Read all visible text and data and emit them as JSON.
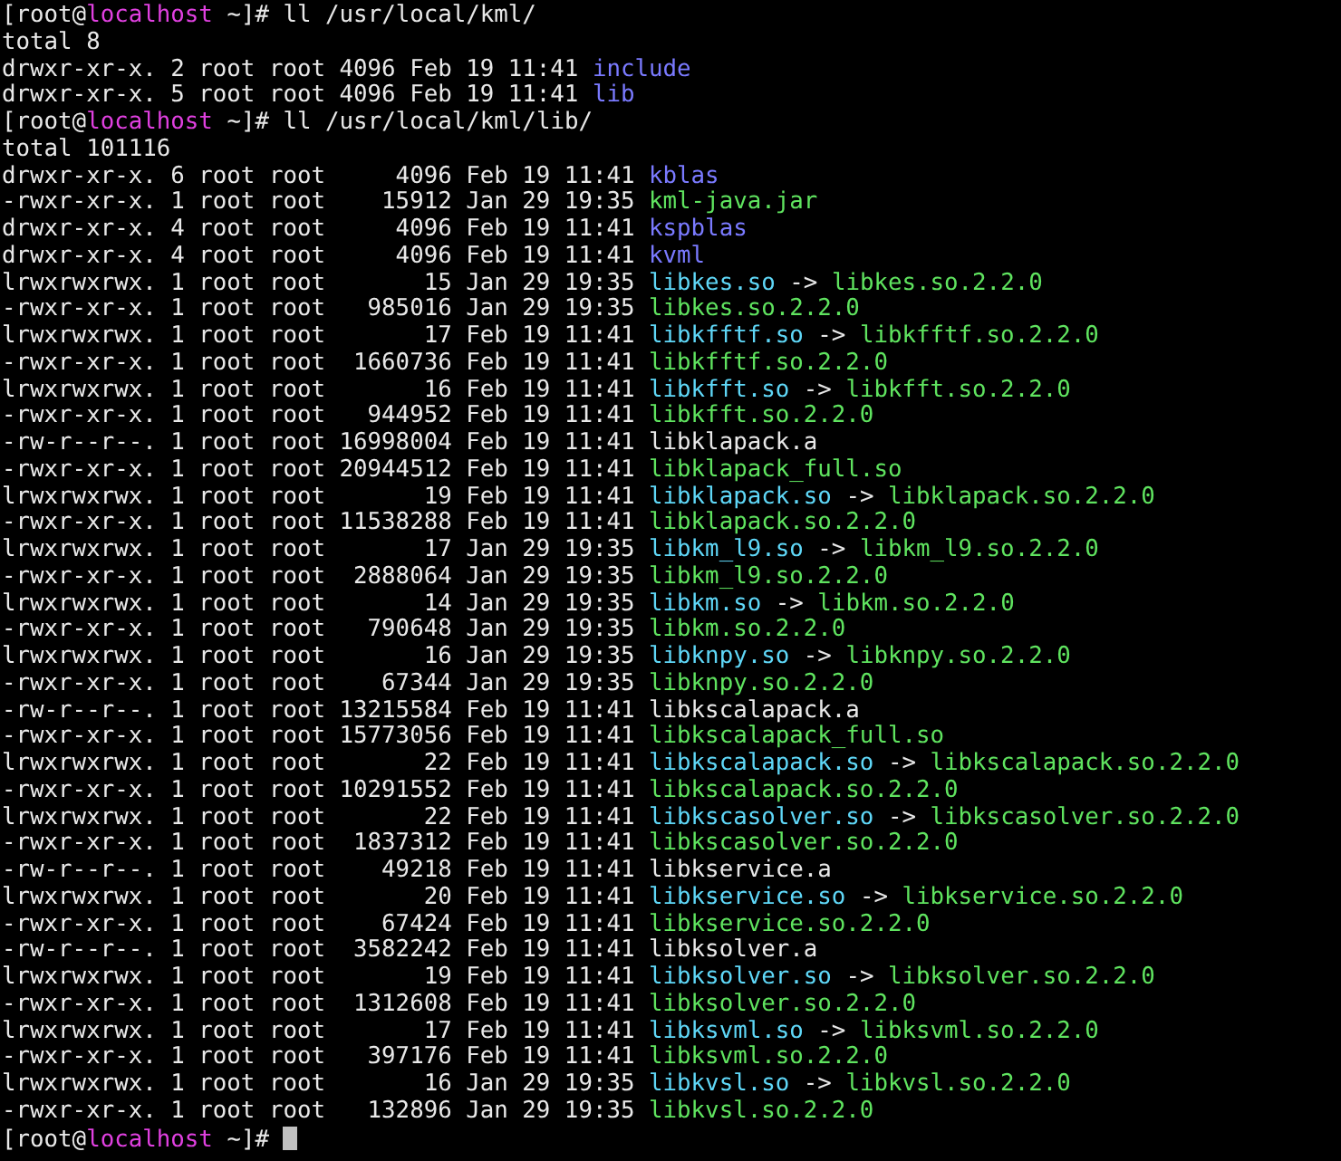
{
  "sessions": [
    {
      "prompt": {
        "head": "[root@",
        "host": "localhost",
        "tail": "~]#"
      },
      "command": "ll /usr/local/kml/",
      "total": "total 8",
      "entries": [
        {
          "mode": "drwxr-xr-x.",
          "links": "2",
          "owner": "root",
          "group": "root",
          "size": "4096",
          "date": "Feb 19 11:41",
          "name": "include",
          "kind": "dir"
        },
        {
          "mode": "drwxr-xr-x.",
          "links": "5",
          "owner": "root",
          "group": "root",
          "size": "4096",
          "date": "Feb 19 11:41",
          "name": "lib",
          "kind": "dir"
        }
      ]
    },
    {
      "prompt": {
        "head": "[root@",
        "host": "localhost",
        "tail": "~]#"
      },
      "command": "ll /usr/local/kml/lib/",
      "total": "total 101116",
      "entries": [
        {
          "mode": "drwxr-xr-x.",
          "links": "6",
          "owner": "root",
          "group": "root",
          "size": "4096",
          "date": "Feb 19 11:41",
          "name": "kblas",
          "kind": "dir"
        },
        {
          "mode": "-rwxr-xr-x.",
          "links": "1",
          "owner": "root",
          "group": "root",
          "size": "15912",
          "date": "Jan 29 19:35",
          "name": "kml-java.jar",
          "kind": "exec"
        },
        {
          "mode": "drwxr-xr-x.",
          "links": "4",
          "owner": "root",
          "group": "root",
          "size": "4096",
          "date": "Feb 19 11:41",
          "name": "kspblas",
          "kind": "dir"
        },
        {
          "mode": "drwxr-xr-x.",
          "links": "4",
          "owner": "root",
          "group": "root",
          "size": "4096",
          "date": "Feb 19 11:41",
          "name": "kvml",
          "kind": "dir"
        },
        {
          "mode": "lrwxrwxrwx.",
          "links": "1",
          "owner": "root",
          "group": "root",
          "size": "15",
          "date": "Jan 29 19:35",
          "name": "libkes.so",
          "kind": "link",
          "target": "libkes.so.2.2.0"
        },
        {
          "mode": "-rwxr-xr-x.",
          "links": "1",
          "owner": "root",
          "group": "root",
          "size": "985016",
          "date": "Jan 29 19:35",
          "name": "libkes.so.2.2.0",
          "kind": "exec"
        },
        {
          "mode": "lrwxrwxrwx.",
          "links": "1",
          "owner": "root",
          "group": "root",
          "size": "17",
          "date": "Feb 19 11:41",
          "name": "libkfftf.so",
          "kind": "link",
          "target": "libkfftf.so.2.2.0"
        },
        {
          "mode": "-rwxr-xr-x.",
          "links": "1",
          "owner": "root",
          "group": "root",
          "size": "1660736",
          "date": "Feb 19 11:41",
          "name": "libkfftf.so.2.2.0",
          "kind": "exec"
        },
        {
          "mode": "lrwxrwxrwx.",
          "links": "1",
          "owner": "root",
          "group": "root",
          "size": "16",
          "date": "Feb 19 11:41",
          "name": "libkfft.so",
          "kind": "link",
          "target": "libkfft.so.2.2.0"
        },
        {
          "mode": "-rwxr-xr-x.",
          "links": "1",
          "owner": "root",
          "group": "root",
          "size": "944952",
          "date": "Feb 19 11:41",
          "name": "libkfft.so.2.2.0",
          "kind": "exec"
        },
        {
          "mode": "-rw-r--r--.",
          "links": "1",
          "owner": "root",
          "group": "root",
          "size": "16998004",
          "date": "Feb 19 11:41",
          "name": "libklapack.a",
          "kind": "file"
        },
        {
          "mode": "-rwxr-xr-x.",
          "links": "1",
          "owner": "root",
          "group": "root",
          "size": "20944512",
          "date": "Feb 19 11:41",
          "name": "libklapack_full.so",
          "kind": "exec"
        },
        {
          "mode": "lrwxrwxrwx.",
          "links": "1",
          "owner": "root",
          "group": "root",
          "size": "19",
          "date": "Feb 19 11:41",
          "name": "libklapack.so",
          "kind": "link",
          "target": "libklapack.so.2.2.0"
        },
        {
          "mode": "-rwxr-xr-x.",
          "links": "1",
          "owner": "root",
          "group": "root",
          "size": "11538288",
          "date": "Feb 19 11:41",
          "name": "libklapack.so.2.2.0",
          "kind": "exec"
        },
        {
          "mode": "lrwxrwxrwx.",
          "links": "1",
          "owner": "root",
          "group": "root",
          "size": "17",
          "date": "Jan 29 19:35",
          "name": "libkm_l9.so",
          "kind": "link",
          "target": "libkm_l9.so.2.2.0"
        },
        {
          "mode": "-rwxr-xr-x.",
          "links": "1",
          "owner": "root",
          "group": "root",
          "size": "2888064",
          "date": "Jan 29 19:35",
          "name": "libkm_l9.so.2.2.0",
          "kind": "exec"
        },
        {
          "mode": "lrwxrwxrwx.",
          "links": "1",
          "owner": "root",
          "group": "root",
          "size": "14",
          "date": "Jan 29 19:35",
          "name": "libkm.so",
          "kind": "link",
          "target": "libkm.so.2.2.0"
        },
        {
          "mode": "-rwxr-xr-x.",
          "links": "1",
          "owner": "root",
          "group": "root",
          "size": "790648",
          "date": "Jan 29 19:35",
          "name": "libkm.so.2.2.0",
          "kind": "exec"
        },
        {
          "mode": "lrwxrwxrwx.",
          "links": "1",
          "owner": "root",
          "group": "root",
          "size": "16",
          "date": "Jan 29 19:35",
          "name": "libknpy.so",
          "kind": "link",
          "target": "libknpy.so.2.2.0"
        },
        {
          "mode": "-rwxr-xr-x.",
          "links": "1",
          "owner": "root",
          "group": "root",
          "size": "67344",
          "date": "Jan 29 19:35",
          "name": "libknpy.so.2.2.0",
          "kind": "exec"
        },
        {
          "mode": "-rw-r--r--.",
          "links": "1",
          "owner": "root",
          "group": "root",
          "size": "13215584",
          "date": "Feb 19 11:41",
          "name": "libkscalapack.a",
          "kind": "file"
        },
        {
          "mode": "-rwxr-xr-x.",
          "links": "1",
          "owner": "root",
          "group": "root",
          "size": "15773056",
          "date": "Feb 19 11:41",
          "name": "libkscalapack_full.so",
          "kind": "exec"
        },
        {
          "mode": "lrwxrwxrwx.",
          "links": "1",
          "owner": "root",
          "group": "root",
          "size": "22",
          "date": "Feb 19 11:41",
          "name": "libkscalapack.so",
          "kind": "link",
          "target": "libkscalapack.so.2.2.0"
        },
        {
          "mode": "-rwxr-xr-x.",
          "links": "1",
          "owner": "root",
          "group": "root",
          "size": "10291552",
          "date": "Feb 19 11:41",
          "name": "libkscalapack.so.2.2.0",
          "kind": "exec"
        },
        {
          "mode": "lrwxrwxrwx.",
          "links": "1",
          "owner": "root",
          "group": "root",
          "size": "22",
          "date": "Feb 19 11:41",
          "name": "libkscasolver.so",
          "kind": "link",
          "target": "libkscasolver.so.2.2.0"
        },
        {
          "mode": "-rwxr-xr-x.",
          "links": "1",
          "owner": "root",
          "group": "root",
          "size": "1837312",
          "date": "Feb 19 11:41",
          "name": "libkscasolver.so.2.2.0",
          "kind": "exec"
        },
        {
          "mode": "-rw-r--r--.",
          "links": "1",
          "owner": "root",
          "group": "root",
          "size": "49218",
          "date": "Feb 19 11:41",
          "name": "libkservice.a",
          "kind": "file"
        },
        {
          "mode": "lrwxrwxrwx.",
          "links": "1",
          "owner": "root",
          "group": "root",
          "size": "20",
          "date": "Feb 19 11:41",
          "name": "libkservice.so",
          "kind": "link",
          "target": "libkservice.so.2.2.0"
        },
        {
          "mode": "-rwxr-xr-x.",
          "links": "1",
          "owner": "root",
          "group": "root",
          "size": "67424",
          "date": "Feb 19 11:41",
          "name": "libkservice.so.2.2.0",
          "kind": "exec"
        },
        {
          "mode": "-rw-r--r--.",
          "links": "1",
          "owner": "root",
          "group": "root",
          "size": "3582242",
          "date": "Feb 19 11:41",
          "name": "libksolver.a",
          "kind": "file"
        },
        {
          "mode": "lrwxrwxrwx.",
          "links": "1",
          "owner": "root",
          "group": "root",
          "size": "19",
          "date": "Feb 19 11:41",
          "name": "libksolver.so",
          "kind": "link",
          "target": "libksolver.so.2.2.0"
        },
        {
          "mode": "-rwxr-xr-x.",
          "links": "1",
          "owner": "root",
          "group": "root",
          "size": "1312608",
          "date": "Feb 19 11:41",
          "name": "libksolver.so.2.2.0",
          "kind": "exec"
        },
        {
          "mode": "lrwxrwxrwx.",
          "links": "1",
          "owner": "root",
          "group": "root",
          "size": "17",
          "date": "Feb 19 11:41",
          "name": "libksvml.so",
          "kind": "link",
          "target": "libksvml.so.2.2.0"
        },
        {
          "mode": "-rwxr-xr-x.",
          "links": "1",
          "owner": "root",
          "group": "root",
          "size": "397176",
          "date": "Feb 19 11:41",
          "name": "libksvml.so.2.2.0",
          "kind": "exec"
        },
        {
          "mode": "lrwxrwxrwx.",
          "links": "1",
          "owner": "root",
          "group": "root",
          "size": "16",
          "date": "Jan 29 19:35",
          "name": "libkvsl.so",
          "kind": "link",
          "target": "libkvsl.so.2.2.0"
        },
        {
          "mode": "-rwxr-xr-x.",
          "links": "1",
          "owner": "root",
          "group": "root",
          "size": "132896",
          "date": "Jan 29 19:35",
          "name": "libkvsl.so.2.2.0",
          "kind": "exec"
        }
      ]
    }
  ],
  "final_prompt": {
    "head": "[root@",
    "host": "localhost",
    "tail": "~]#"
  },
  "arrow": "->"
}
